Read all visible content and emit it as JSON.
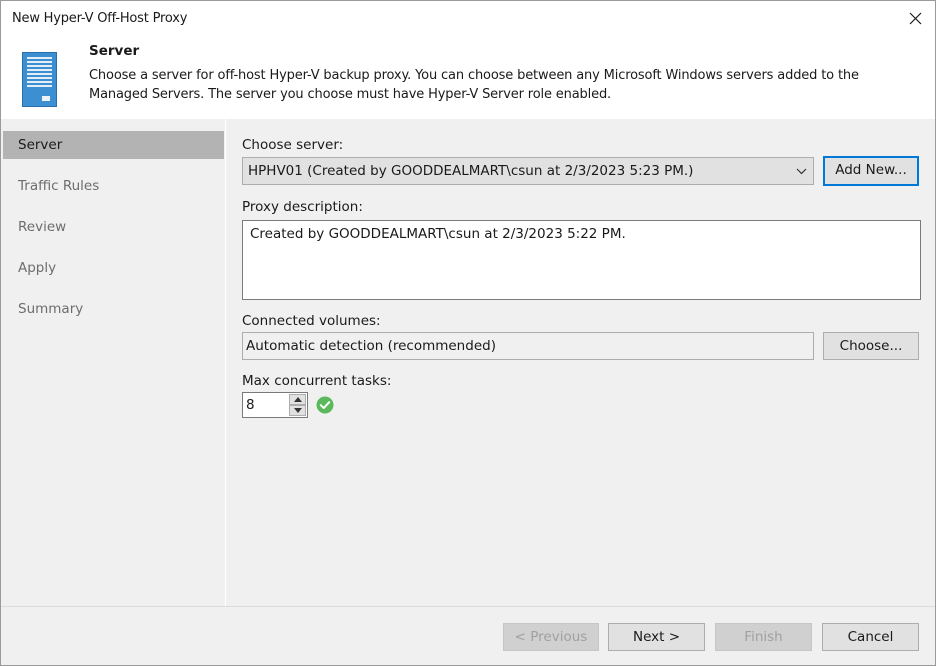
{
  "window": {
    "title": "New Hyper-V Off-Host Proxy"
  },
  "header": {
    "title": "Server",
    "description": "Choose a server for off-host Hyper-V backup proxy. You can choose between any Microsoft Windows servers added to the Managed Servers. The server you choose must have Hyper-V Server role enabled.",
    "icon": "server-icon"
  },
  "nav": {
    "items": [
      {
        "label": "Server",
        "active": true
      },
      {
        "label": "Traffic Rules",
        "active": false
      },
      {
        "label": "Review",
        "active": false
      },
      {
        "label": "Apply",
        "active": false
      },
      {
        "label": "Summary",
        "active": false
      }
    ]
  },
  "form": {
    "choose_server_label": "Choose server:",
    "server_value": "HPHV01 (Created by GOODDEALMART\\csun at 2/3/2023 5:23 PM.)",
    "add_new_label": "Add New...",
    "proxy_description_label": "Proxy description:",
    "proxy_description_value": "Created by GOODDEALMART\\csun at 2/3/2023 5:22 PM.",
    "connected_volumes_label": "Connected volumes:",
    "connected_volumes_value": "Automatic detection (recommended)",
    "choose_label": "Choose...",
    "max_tasks_label": "Max concurrent tasks:",
    "max_tasks_value": "8",
    "status_icon": "check-circle-icon"
  },
  "footer": {
    "previous_label": "< Previous",
    "next_label": "Next >",
    "finish_label": "Finish",
    "cancel_label": "Cancel"
  },
  "colors": {
    "accent": "#0078d7",
    "nav_active_bg": "#b3b3b3",
    "panel_bg": "#f0f0f0",
    "success": "#5cb85c"
  }
}
